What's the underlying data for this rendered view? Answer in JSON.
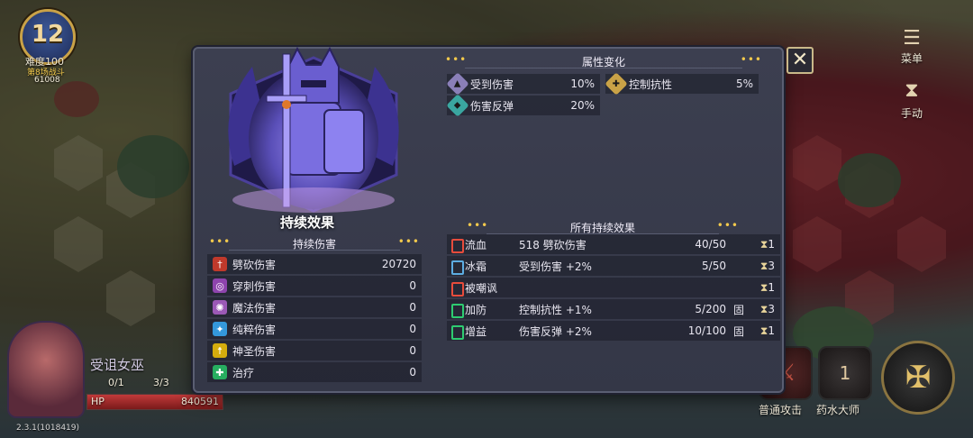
{
  "hud": {
    "level": "12",
    "difficulty": "难度100",
    "wave": "第8场战斗",
    "gold": "61008",
    "menu_label": "菜单",
    "mode_label": "手动",
    "version": "2.3.1(1018419)"
  },
  "hero": {
    "name": "受诅女巫",
    "stat_a": "0/1",
    "stat_b": "3/3",
    "hp_label": "HP",
    "hp_value": "840591",
    "hp_fill_fraction": 1.0
  },
  "skills": {
    "normal_attack_label": "普通攻击",
    "potion_master_label": "药水大师",
    "potion_count": "1"
  },
  "modal": {
    "title": "持续效果",
    "dot_section_title": "持续伤害",
    "damage_types": [
      {
        "label": "劈砍伤害",
        "value": "20720",
        "icon_color": "#c0392b",
        "icon_glyph": "†"
      },
      {
        "label": "穿刺伤害",
        "value": "0",
        "icon_color": "#8e44ad",
        "icon_glyph": "◎"
      },
      {
        "label": "魔法伤害",
        "value": "0",
        "icon_color": "#9b59b6",
        "icon_glyph": "✺"
      },
      {
        "label": "纯粹伤害",
        "value": "0",
        "icon_color": "#3498db",
        "icon_glyph": "✦"
      },
      {
        "label": "神圣伤害",
        "value": "0",
        "icon_color": "#d4ac0d",
        "icon_glyph": "☨"
      },
      {
        "label": "治疗",
        "value": "0",
        "icon_color": "#27ae60",
        "icon_glyph": "✚"
      }
    ],
    "attr_section_title": "属性变化",
    "attributes": [
      {
        "label": "受到伤害",
        "value": "10%",
        "icon_color": "#8a7fb8",
        "icon_glyph": "▲"
      },
      {
        "label": "控制抗性",
        "value": "5%",
        "icon_color": "#c9a247",
        "icon_glyph": "✚"
      },
      {
        "label": "伤害反弹",
        "value": "20%",
        "icon_color": "#3aa6a0",
        "icon_glyph": "◆"
      }
    ],
    "effects_section_title": "所有持续效果",
    "effects": [
      {
        "name": "流血",
        "desc": "518 劈砍伤害",
        "fraction": "40/50",
        "fixed": "",
        "stack": "1",
        "color": "#e74c3c"
      },
      {
        "name": "冰霜",
        "desc": "受到伤害 +2%",
        "fraction": "5/50",
        "fixed": "",
        "stack": "3",
        "color": "#5dade2"
      },
      {
        "name": "被嘲讽",
        "desc": "",
        "fraction": "",
        "fixed": "",
        "stack": "1",
        "color": "#e74c3c"
      },
      {
        "name": "加防",
        "desc": "控制抗性 +1%",
        "fraction": "5/200",
        "fixed": "固",
        "stack": "3",
        "color": "#2ecc71"
      },
      {
        "name": "增益",
        "desc": "伤害反弹 +2%",
        "fraction": "10/100",
        "fixed": "固",
        "stack": "1",
        "color": "#2ecc71"
      }
    ],
    "close_label": "✕",
    "dots": "•••"
  }
}
